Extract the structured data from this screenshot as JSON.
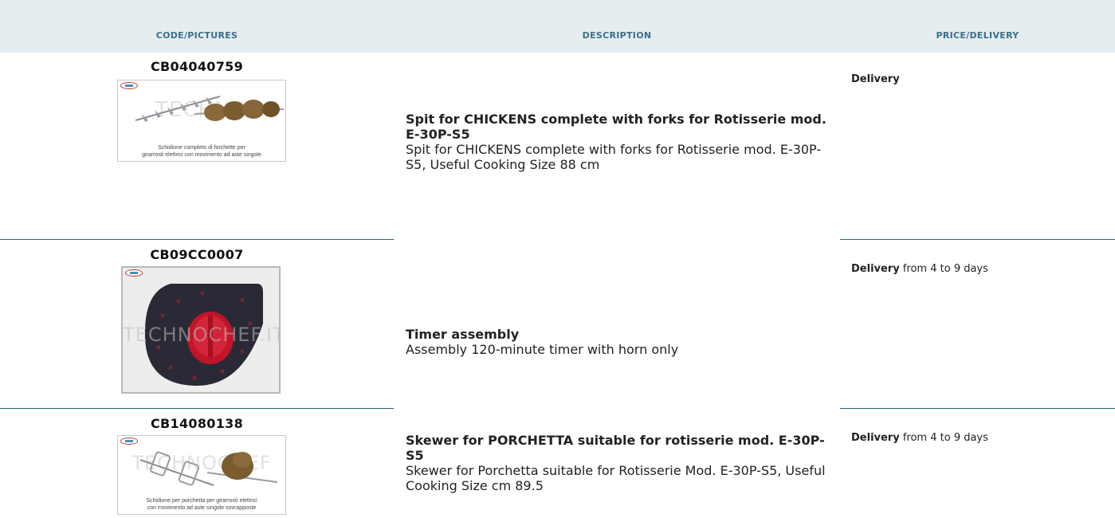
{
  "table": {
    "columns": [
      "CODE/PICTURES",
      "DESCRIPTION",
      "PRICE/DELIVERY"
    ]
  },
  "products": [
    {
      "code": "CB04040759",
      "image_caption_line1": "Schidione completo di forchette per",
      "image_caption_line2": "girarrosti elettrici con movimento ad aste singole",
      "watermark": "TECHNO",
      "title": "Spit for CHICKENS complete with forks for Rotisserie mod. E-30P-S5",
      "description": "Spit for CHICKENS complete with forks for Rotisserie mod. E-30P-S5, Useful Cooking Size 88 cm",
      "delivery_label": "Delivery",
      "delivery_text": ""
    },
    {
      "code": "CB09CC0007",
      "image_caption_line1": "",
      "image_caption_line2": "",
      "watermark": "TECHNOCHEF.IT",
      "title": "Timer assembly",
      "description": "Assembly 120-minute timer with horn only",
      "delivery_label": "Delivery",
      "delivery_text": "from 4 to 9 days"
    },
    {
      "code": "CB14080138",
      "image_caption_line1": "Schidione per porchetta per girarrosti elettrici",
      "image_caption_line2": "con movimento ad aste singole sovrapposte",
      "watermark": "TECHNOCHEF",
      "title": "Skewer for PORCHETTA suitable for rotisserie mod. E-30P-S5",
      "description": "Skewer for Porchetta suitable for Rotisserie Mod. E-30P-S5, Useful Cooking Size cm 89.5",
      "delivery_label": "Delivery",
      "delivery_text": "from 4 to 9 days"
    }
  ],
  "colors": {
    "header_bg": "#e5edf1",
    "header_text": "#3b6e8a",
    "divider": "#2f5f7a",
    "timer_knob": "#c0152a",
    "timer_plate": "#2a2a36"
  }
}
